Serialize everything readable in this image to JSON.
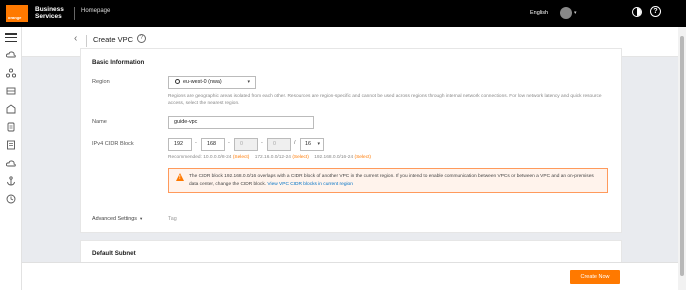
{
  "topbar": {
    "logo_text": "orange",
    "brand_line1": "Business",
    "brand_line2": "Services",
    "home_link": "Homepage",
    "language": "English"
  },
  "header": {
    "title": "Create VPC"
  },
  "basic": {
    "section_title": "Basic Information",
    "region_label": "Region",
    "region_value": "eu-west-0 (nwa)",
    "region_hint": "Regions are geographic areas isolated from each other. Resources are region-specific and cannot be used across regions through internal network connections. For low network latency and quick resource access, select the nearest region.",
    "name_label": "Name",
    "name_value": "guide-vpc",
    "cidr_label": "IPv4 CIDR Block",
    "cidr_octets": [
      "192",
      "168",
      "0",
      "0"
    ],
    "cidr_mask": "16",
    "recommended_label": "Recommended: ",
    "recommended": [
      {
        "cidr": "10.0.0.0/8-24",
        "action": "(Select)"
      },
      {
        "cidr": "172.16.0.0/12-24",
        "action": "(Select)"
      },
      {
        "cidr": "192.168.0.0/16-24",
        "action": "(Select)"
      }
    ],
    "warning_text": "The CIDR block 192.168.0.0/16 overlaps with a CIDR block of another VPC in the current region. If you intend to enable communication between VPCs or between a VPC and an on-premises data center, change the CIDR block.",
    "warning_link": "View VPC CIDR blocks in current region",
    "advanced_label": "Advanced Settings",
    "tag_label": "Tag"
  },
  "subnet": {
    "section_title": "Default Subnet"
  },
  "footer": {
    "create_label": "Create Now"
  },
  "colors": {
    "accent": "#ff7900",
    "topbar": "#000000",
    "link": "#0072c6"
  }
}
